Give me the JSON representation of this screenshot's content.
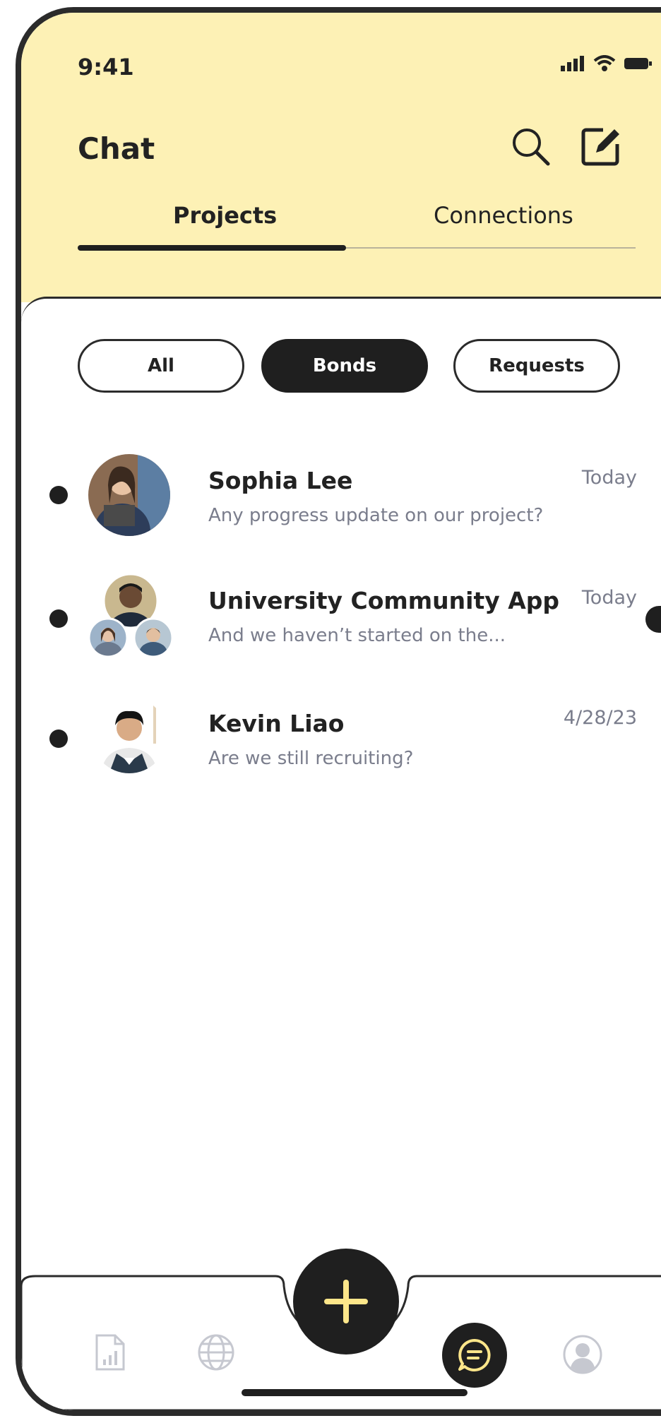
{
  "status_bar": {
    "time": "9:41"
  },
  "header": {
    "title": "Chat",
    "tabs": [
      {
        "label": "Projects",
        "active": true
      },
      {
        "label": "Connections",
        "active": false
      }
    ]
  },
  "filters": [
    {
      "label": "All",
      "selected": false
    },
    {
      "label": "Bonds",
      "selected": true
    },
    {
      "label": "Requests",
      "selected": false
    }
  ],
  "conversations": [
    {
      "name": "Sophia Lee",
      "preview": "Any progress update on our project?",
      "date": "Today",
      "unread": true
    },
    {
      "name": "University Community App",
      "preview": "And we haven’t started on the...",
      "date": "Today",
      "unread": true
    },
    {
      "name": "Kevin Liao",
      "preview": "Are we still recruiting?",
      "date": "4/28/23",
      "unread": true
    }
  ],
  "bottom_nav": {
    "items": [
      "analytics-icon",
      "globe-icon",
      "chat-icon",
      "profile-icon"
    ],
    "active": "chat-icon",
    "fab_icon": "plus-icon"
  },
  "colors": {
    "header_bg": "#fdf1b5",
    "accent_dark": "#1f1f1f",
    "fab_plus": "#fde68a",
    "muted_text": "#7a7d8c"
  }
}
